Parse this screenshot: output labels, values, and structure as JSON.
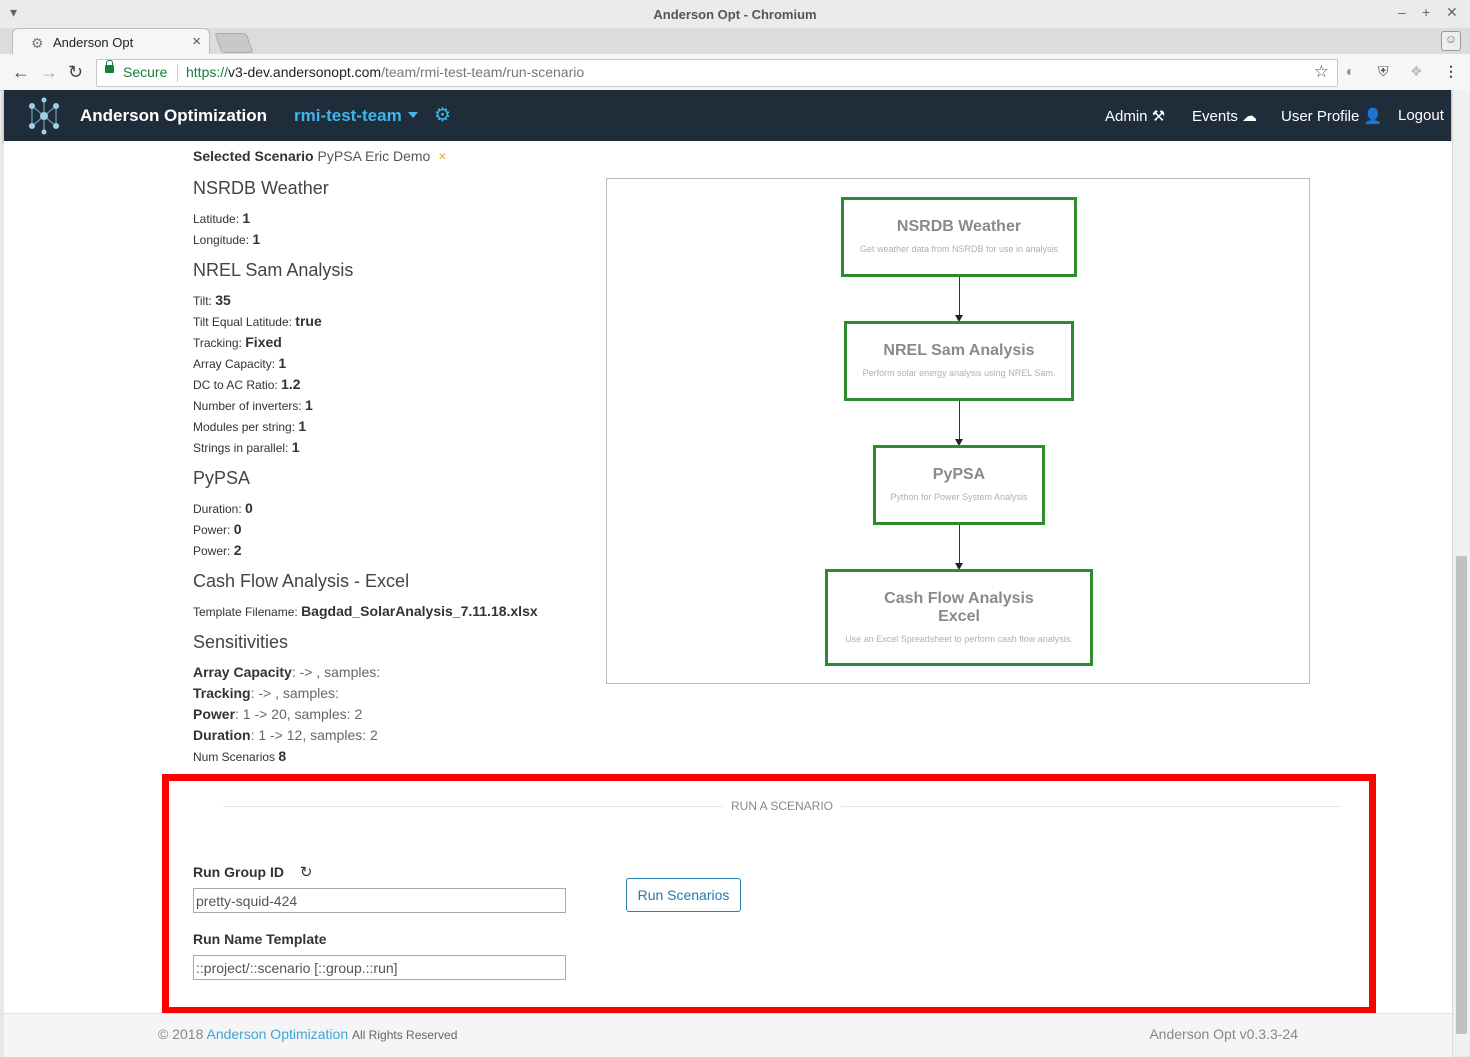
{
  "window": {
    "title": "Anderson Opt - Chromium"
  },
  "tab": {
    "title": "Anderson Opt"
  },
  "address": {
    "secure_label": "Secure",
    "scheme": "https://",
    "host": "v3-dev.andersonopt.com",
    "path": "/team/rmi-test-team/run-scenario"
  },
  "nav": {
    "brand": "Anderson Optimization",
    "team": "rmi-test-team",
    "admin": "Admin",
    "events": "Events",
    "user_profile": "User Profile",
    "logout": "Logout"
  },
  "scenario": {
    "label": "Selected Scenario",
    "name": "PyPSA Eric Demo",
    "remove": "×"
  },
  "sections": {
    "nsrdb": {
      "title": "NSRDB Weather",
      "latitude_label": "Latitude:",
      "latitude": "1",
      "longitude_label": "Longitude:",
      "longitude": "1"
    },
    "nrel": {
      "title": "NREL Sam Analysis",
      "tilt_label": "Tilt:",
      "tilt": "35",
      "tilt_eq_label": "Tilt Equal Latitude:",
      "tilt_eq": "true",
      "tracking_label": "Tracking:",
      "tracking": "Fixed",
      "array_cap_label": "Array Capacity:",
      "array_cap": "1",
      "dc_ac_label": "DC to AC Ratio:",
      "dc_ac": "1.2",
      "inverters_label": "Number of inverters:",
      "inverters": "1",
      "modules_label": "Modules per string:",
      "modules": "1",
      "strings_label": "Strings in parallel:",
      "strings": "1"
    },
    "pypsa": {
      "title": "PyPSA",
      "duration_label": "Duration:",
      "duration": "0",
      "power1_label": "Power:",
      "power1": "0",
      "power2_label": "Power:",
      "power2": "2"
    },
    "cashflow": {
      "title": "Cash Flow Analysis - Excel",
      "template_label": "Template Filename:",
      "template": "Bagdad_SolarAnalysis_7.11.18.xlsx"
    },
    "sensitivities": {
      "title": "Sensitivities",
      "items": [
        {
          "name": "Array Capacity",
          "detail": ": -> , samples:"
        },
        {
          "name": "Tracking",
          "detail": ": -> , samples:"
        },
        {
          "name": "Power",
          "detail": ": 1 -> 20, samples: 2"
        },
        {
          "name": "Duration",
          "detail": ": 1 -> 12, samples: 2"
        }
      ],
      "num_label": "Num Scenarios",
      "num": "8"
    }
  },
  "diagram": {
    "nodes": [
      {
        "title": "NSRDB Weather",
        "desc": "Get weather data from NSRDB for use in analysis"
      },
      {
        "title": "NREL Sam Analysis",
        "desc": "Perform solar energy analysis using NREL Sam."
      },
      {
        "title": "PyPSA",
        "desc": "Python for Power System Analysis"
      },
      {
        "title": "Cash Flow Analysis\nExcel",
        "desc": "Use an Excel Spreadsheet to perform cash flow analysis."
      }
    ]
  },
  "run": {
    "heading": "RUN A SCENARIO",
    "group_id_label": "Run Group ID",
    "group_id_value": "pretty-squid-424",
    "name_template_label": "Run Name Template",
    "name_template_value": "::project/::scenario [::group.::run]",
    "button": "Run Scenarios"
  },
  "footer": {
    "copyright": "© 2018",
    "company": "Anderson Optimization",
    "rights": "All Rights Reserved",
    "version": "Anderson Opt v0.3.3-24"
  },
  "colors": {
    "navbar": "#1f2d3a",
    "accent": "#3fb5e8",
    "node_border": "#2e8b2e",
    "highlight": "#ff0000"
  }
}
